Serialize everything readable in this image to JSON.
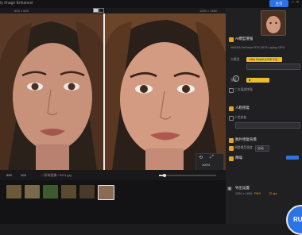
{
  "app": {
    "title": "ty Image Enhancer"
  },
  "header": {
    "blue_button": "主页",
    "window_controls": "—  ✕"
  },
  "toolbar": {
    "dim_left": "625 × 825",
    "dim_right": "1250 × 1650"
  },
  "zoom": {
    "label": "100%"
  },
  "bottombar": {
    "res_a": "999",
    "res_b": "103",
    "folder": "□ 所有图像 / 0011.jpg"
  },
  "panel": {
    "section_ai": "AI模型增强",
    "model_desc": "NVIDIA GeForce RTX 4070 Laptop GPU",
    "label_model": "大模型",
    "model_value": "Ultra Detail (UHD 4X)",
    "label_detail": "强度",
    "detail_value": "■ ",
    "check_face": "二次面部增强",
    "section_face": "人脸修复",
    "check_face2": "人脸修复",
    "section_bg": "图片修复背景",
    "check_bg": "调整模型强度",
    "bg_value": "自动",
    "section_denoise": "降噪",
    "export_title": "导出设置",
    "export_size": "1250 × 1650",
    "export_fmt": "PNG",
    "export_dpi": "72 dpi",
    "run_label": "RUN"
  },
  "colors": {
    "accent": "#2a74e4",
    "highlight": "#ecbd29"
  }
}
